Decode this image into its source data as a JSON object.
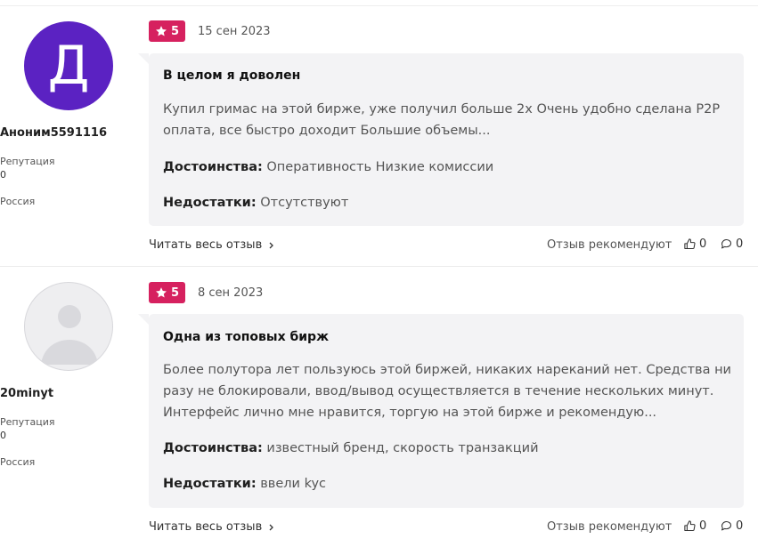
{
  "reviews": [
    {
      "author": {
        "avatar_letter": "Д",
        "name": "Аноним5591116",
        "reputation_label": "Репутация",
        "reputation_value": "0",
        "country": "Россия"
      },
      "rating": "5",
      "date": "15 сен 2023",
      "title": "В целом я доволен",
      "body": "Купил гримас на этой бирже, уже получил больше 2х Очень удобно сделана P2P оплата, все быстро доходит Большие объемы...",
      "pros_label": "Достоинства:",
      "pros": "Оперативность Низкие комиссии",
      "cons_label": "Недостатки:",
      "cons": "Отсутствуют",
      "read_more": "Читать весь отзыв",
      "recommend_label": "Отзыв рекомендуют",
      "likes": "0",
      "comments": "0"
    },
    {
      "author": {
        "name": "20minyt",
        "reputation_label": "Репутация",
        "reputation_value": "0",
        "country": "Россия"
      },
      "rating": "5",
      "date": "8 сен 2023",
      "title": "Одна из топовых бирж",
      "body": "Более полутора лет пользуюсь этой биржей, никаких нареканий нет. Средства ни разу не блокировали, ввод/вывод осуществляется в течение нескольких минут. Интерфейс лично мне нравится, торгую на этой бирже и рекомендую...",
      "pros_label": "Достоинства:",
      "pros": "известный бренд, скорость транзакций",
      "cons_label": "Недостатки:",
      "cons": "ввели kyc",
      "read_more": "Читать весь отзыв",
      "recommend_label": "Отзыв рекомендуют",
      "likes": "0",
      "comments": "0"
    }
  ]
}
